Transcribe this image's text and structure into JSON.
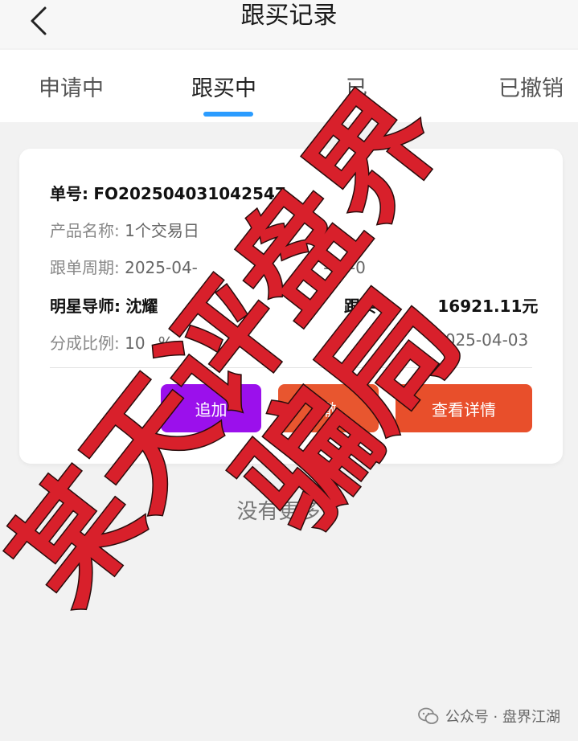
{
  "header": {
    "title": "跟买记录",
    "back_icon": "chevron-left-icon"
  },
  "tabs": [
    {
      "label": "申请中"
    },
    {
      "label": "跟买中",
      "active": true
    },
    {
      "label": "已"
    },
    {
      "label": "已撤销"
    }
  ],
  "card": {
    "order_label": "单号:",
    "order_value": "FO202504031042547",
    "product_label": "产品名称:",
    "product_value": "1个交易日",
    "period_label": "跟单周期:",
    "period_value": "2025-04-",
    "period_value_tail": "-04-0",
    "mentor_label": "明星导师:",
    "mentor_value": "沈耀",
    "amount_label": "跟买",
    "amount_value": "16921.11元",
    "ratio_label": "分成比例:",
    "ratio_value": "10",
    "ratio_value_tail": "%",
    "date_value": "2025-04-03",
    "buttons": {
      "purple_label": "追加",
      "orange_label": "撤",
      "details_label": "查看详情"
    }
  },
  "footer": {
    "no_more": "没有更多了",
    "source": "公众号 · 盘界江湖"
  },
  "watermark": {
    "line1": "某天评盘界",
    "line2": "骗局"
  },
  "colors": {
    "accent_tab": "#2b9cff",
    "button_purple": "#9b10ec",
    "button_orange": "#e8562f",
    "button_red": "#e84f2b",
    "watermark_red": "#d8202b"
  }
}
